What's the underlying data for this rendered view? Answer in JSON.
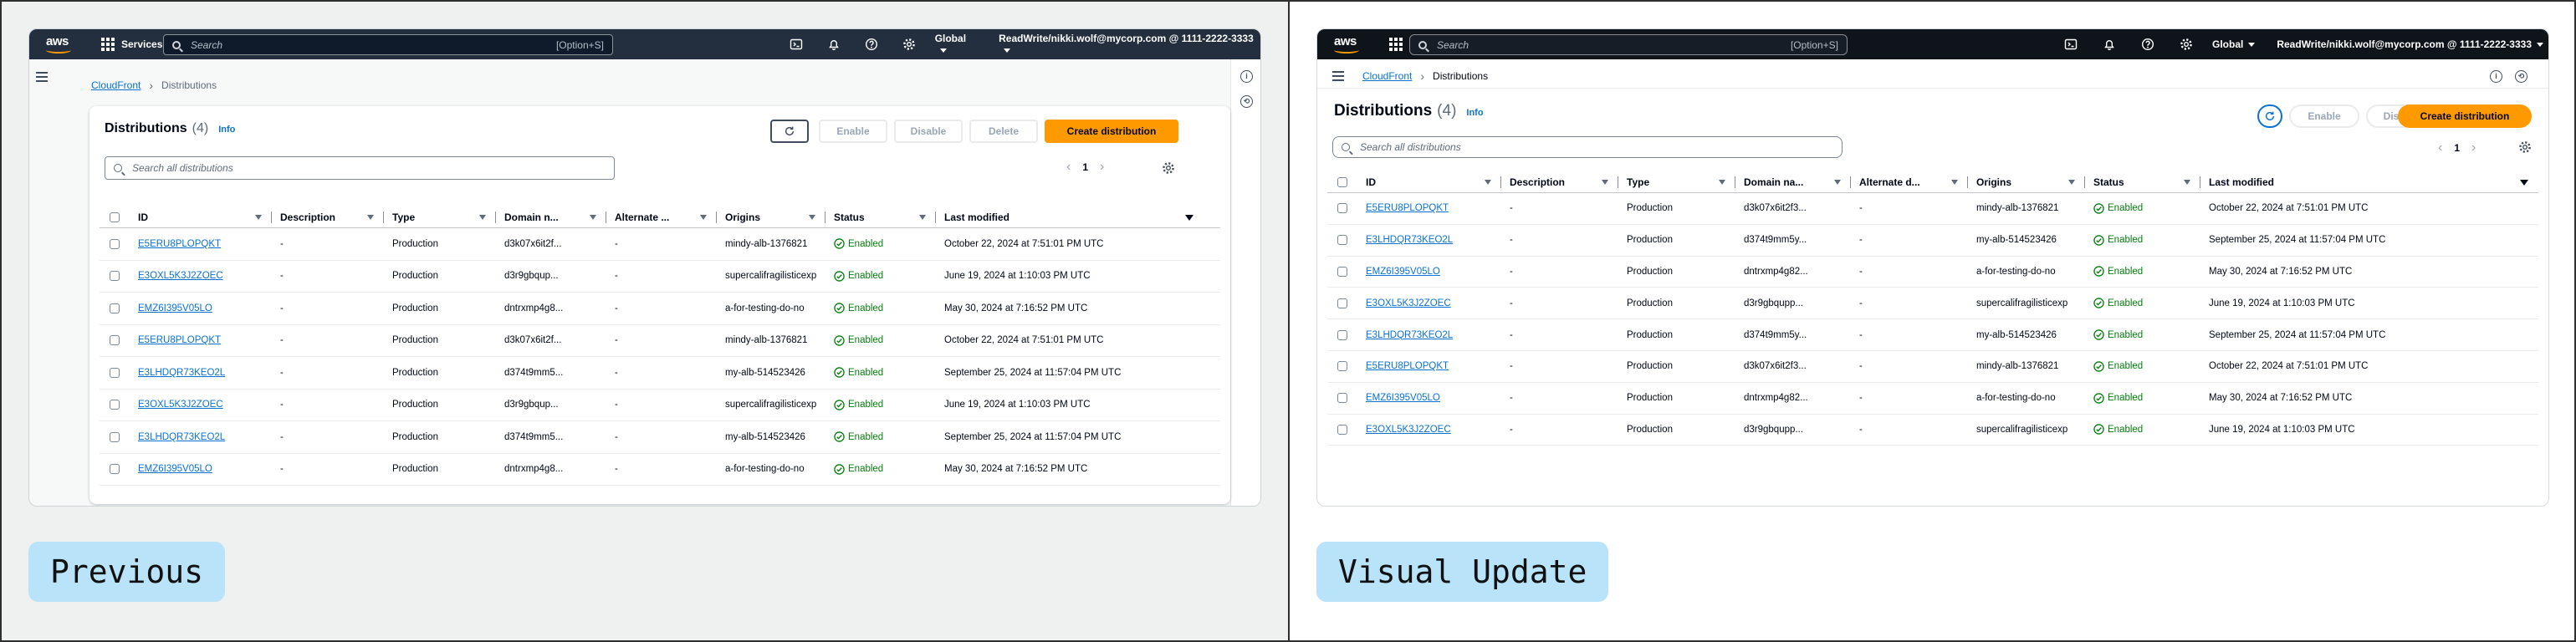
{
  "labels": {
    "previous": "Previous",
    "visual_update": "Visual Update"
  },
  "colors": {
    "prev_nav_bg": "#232f3e",
    "vis_nav_bg": "#0f141a",
    "primary": "#ff9900",
    "link": "#0972d3",
    "success": "#037f0c"
  },
  "nav": {
    "logo": "aws",
    "services": "Services",
    "search_placeholder": "Search",
    "search_shortcut": "[Option+S]",
    "region": "Global",
    "account": "ReadWrite/nikki.wolf@mycorp.com @ 1111-2222-3333",
    "icons": [
      "cloudshell-icon",
      "notifications-bell-icon",
      "help-icon",
      "settings-gear-icon"
    ]
  },
  "breadcrumb": {
    "root": "CloudFront",
    "current": "Distributions"
  },
  "header": {
    "title": "Distributions",
    "count": "(4)",
    "info": "Info",
    "enable": "Enable",
    "disable": "Disable",
    "delete": "Delete",
    "create": "Create distribution",
    "search_placeholder": "Search all distributions",
    "page": "1"
  },
  "columns": [
    "ID",
    "Description",
    "Type",
    "Domain name",
    "Alternate domain names",
    "Origins",
    "Status",
    "Last modified"
  ],
  "prev_headers": [
    "ID",
    "Description",
    "Type",
    "Domain n...",
    "Alternate ...",
    "Origins",
    "Status",
    "Last modified"
  ],
  "vis_headers": [
    "ID",
    "Description",
    "Type",
    "Domain na...",
    "Alternate d...",
    "Origins",
    "Status",
    "Last modified"
  ],
  "previous_rows": [
    {
      "id": "E5ERU8PLOPQKT",
      "description": "-",
      "type": "Production",
      "domain": "d3k07x6it2f...",
      "alternate": "-",
      "origins": "mindy-alb-1376821",
      "status": "Enabled",
      "modified": "October 22, 2024 at 7:51:01 PM UTC"
    },
    {
      "id": "E3OXL5K3J2ZOEC",
      "description": "-",
      "type": "Production",
      "domain": "d3r9gbqup...",
      "alternate": "-",
      "origins": "supercalifragilisticexp",
      "status": "Enabled",
      "modified": "June 19, 2024 at 1:10:03 PM UTC"
    },
    {
      "id": "EMZ6I395V05LO",
      "description": "-",
      "type": "Production",
      "domain": "dntrxmp4g8...",
      "alternate": "-",
      "origins": "a-for-testing-do-no",
      "status": "Enabled",
      "modified": "May 30, 2024 at 7:16:52 PM UTC"
    },
    {
      "id": "E5ERU8PLOPQKT",
      "description": "-",
      "type": "Production",
      "domain": "d3k07x6it2f...",
      "alternate": "-",
      "origins": "mindy-alb-1376821",
      "status": "Enabled",
      "modified": "October 22, 2024 at 7:51:01 PM UTC"
    },
    {
      "id": "E3LHDQR73KEO2L",
      "description": "-",
      "type": "Production",
      "domain": "d374t9mm5...",
      "alternate": "-",
      "origins": "my-alb-514523426",
      "status": "Enabled",
      "modified": "September 25, 2024 at 11:57:04 PM UTC"
    },
    {
      "id": "E3OXL5K3J2ZOEC",
      "description": "-",
      "type": "Production",
      "domain": "d3r9gbqup...",
      "alternate": "-",
      "origins": "supercalifragilisticexp",
      "status": "Enabled",
      "modified": "June 19, 2024 at 1:10:03 PM UTC"
    },
    {
      "id": "E3LHDQR73KEO2L",
      "description": "-",
      "type": "Production",
      "domain": "d374t9mm5...",
      "alternate": "-",
      "origins": "my-alb-514523426",
      "status": "Enabled",
      "modified": "September 25, 2024 at 11:57:04 PM UTC"
    },
    {
      "id": "EMZ6I395V05LO",
      "description": "-",
      "type": "Production",
      "domain": "dntrxmp4g8...",
      "alternate": "-",
      "origins": "a-for-testing-do-no",
      "status": "Enabled",
      "modified": "May 30, 2024 at 7:16:52 PM UTC"
    }
  ],
  "visual_rows": [
    {
      "id": "E5ERU8PLOPQKT",
      "description": "-",
      "type": "Production",
      "domain": "d3k07x6it2f3...",
      "alternate": "-",
      "origins": "mindy-alb-1376821",
      "status": "Enabled",
      "modified": "October 22, 2024 at 7:51:01 PM UTC"
    },
    {
      "id": "E3LHDQR73KEO2L",
      "description": "-",
      "type": "Production",
      "domain": "d374t9mm5y...",
      "alternate": "-",
      "origins": "my-alb-514523426",
      "status": "Enabled",
      "modified": "September 25, 2024 at 11:57:04 PM UTC"
    },
    {
      "id": "EMZ6I395V05LO",
      "description": "-",
      "type": "Production",
      "domain": "dntrxmp4g82...",
      "alternate": "-",
      "origins": "a-for-testing-do-no",
      "status": "Enabled",
      "modified": "May 30, 2024 at 7:16:52 PM UTC"
    },
    {
      "id": "E3OXL5K3J2ZOEC",
      "description": "-",
      "type": "Production",
      "domain": "d3r9gbqupp...",
      "alternate": "-",
      "origins": "supercalifragilisticexp",
      "status": "Enabled",
      "modified": "June 19, 2024 at 1:10:03 PM UTC"
    },
    {
      "id": "E3LHDQR73KEO2L",
      "description": "-",
      "type": "Production",
      "domain": "d374t9mm5y...",
      "alternate": "-",
      "origins": "my-alb-514523426",
      "status": "Enabled",
      "modified": "September 25, 2024 at 11:57:04 PM UTC"
    },
    {
      "id": "E5ERU8PLOPQKT",
      "description": "-",
      "type": "Production",
      "domain": "d3k07x6it2f3...",
      "alternate": "-",
      "origins": "mindy-alb-1376821",
      "status": "Enabled",
      "modified": "October 22, 2024 at 7:51:01 PM UTC"
    },
    {
      "id": "EMZ6I395V05LO",
      "description": "-",
      "type": "Production",
      "domain": "dntrxmp4g82...",
      "alternate": "-",
      "origins": "a-for-testing-do-no",
      "status": "Enabled",
      "modified": "May 30, 2024 at 7:16:52 PM UTC"
    },
    {
      "id": "E3OXL5K3J2ZOEC",
      "description": "-",
      "type": "Production",
      "domain": "d3r9gbqupp...",
      "alternate": "-",
      "origins": "supercalifragilisticexp",
      "status": "Enabled",
      "modified": "June 19, 2024 at 1:10:03 PM UTC"
    }
  ]
}
